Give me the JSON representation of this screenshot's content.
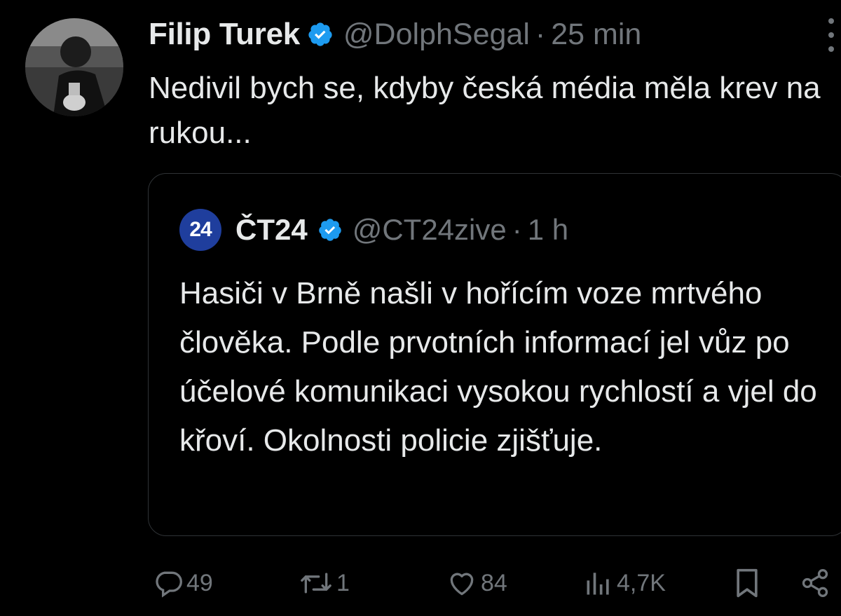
{
  "tweet": {
    "author": {
      "display_name": "Filip Turek",
      "handle": "@DolphSegal",
      "separator": "·",
      "time": "25 min"
    },
    "text": "Nedivil bych se, kdyby česká média měla krev na rukou...",
    "quoted": {
      "avatar_text": "24",
      "display_name": "ČT24",
      "handle": "@CT24zive",
      "separator": "·",
      "time": "1 h",
      "text": "Hasiči v Brně našli v hořícím voze mrtvého člověka. Podle prvotních informací jel vůz po účelové komunikaci vysokou rychlostí a vjel do křoví. Okolnosti policie zjišťuje."
    },
    "actions": {
      "replies": "49",
      "reposts": "1",
      "likes": "84",
      "views": "4,7K"
    }
  },
  "icons": {
    "verified": "verified-badge-icon",
    "more": "more-vertical-icon",
    "reply": "reply-icon",
    "repost": "repost-icon",
    "like": "heart-icon",
    "views": "views-icon",
    "bookmark": "bookmark-icon",
    "share": "share-icon"
  },
  "colors": {
    "background": "#000000",
    "text_primary": "#e7e9ea",
    "text_secondary": "#71767b",
    "verified_blue": "#1d9bf0",
    "ct24_blue": "#1f3e9d",
    "border": "#2f3336"
  }
}
